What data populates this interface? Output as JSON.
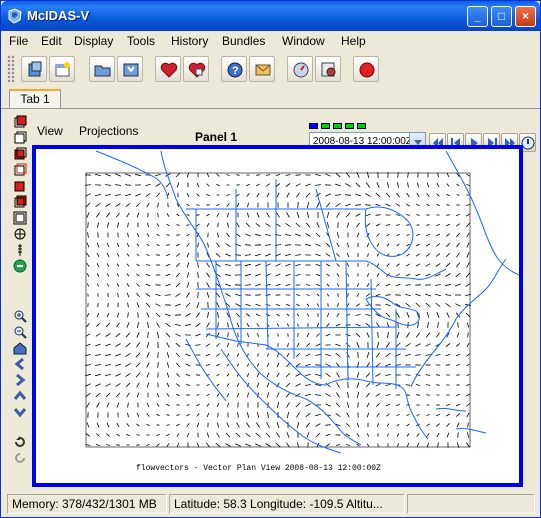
{
  "window": {
    "title": "McIDAS-V",
    "minimize": "_",
    "maximize": "□",
    "close": "×"
  },
  "menu": [
    {
      "label": "File"
    },
    {
      "label": "Edit"
    },
    {
      "label": "Display"
    },
    {
      "label": "Tools"
    },
    {
      "label": "History"
    },
    {
      "label": "Bundles"
    },
    {
      "label": "Window"
    },
    {
      "label": "Help"
    }
  ],
  "toolbar_icons": [
    "data-explorer-icon",
    "new-window-icon",
    "open-icon",
    "save-icon",
    "favorite-icon",
    "favorites-manage-icon",
    "help-icon",
    "forum-icon",
    "user-prefs-icon",
    "layer-controls-icon",
    "stop-icon"
  ],
  "tab": {
    "label": "Tab 1"
  },
  "panel": {
    "view_menu": "View",
    "projections_menu": "Projections",
    "title": "Panel 1",
    "time": "2008-08-13 12:00:00Z",
    "animation_indicator_colors": [
      "#0000FF",
      "#00CC00",
      "#00CC00",
      "#00CC00",
      "#00CC00"
    ]
  },
  "map": {
    "caption": "flowvectors - Vector Plan View 2008-08-13 12:00:00Z",
    "map_line_color": "#1E64FF",
    "frame_color": "#0000E8"
  },
  "status": {
    "memory": "Memory: 378/432/1301 MB",
    "location": "Latitude:   58.3 Longitude: -109.5 Altitu..."
  }
}
